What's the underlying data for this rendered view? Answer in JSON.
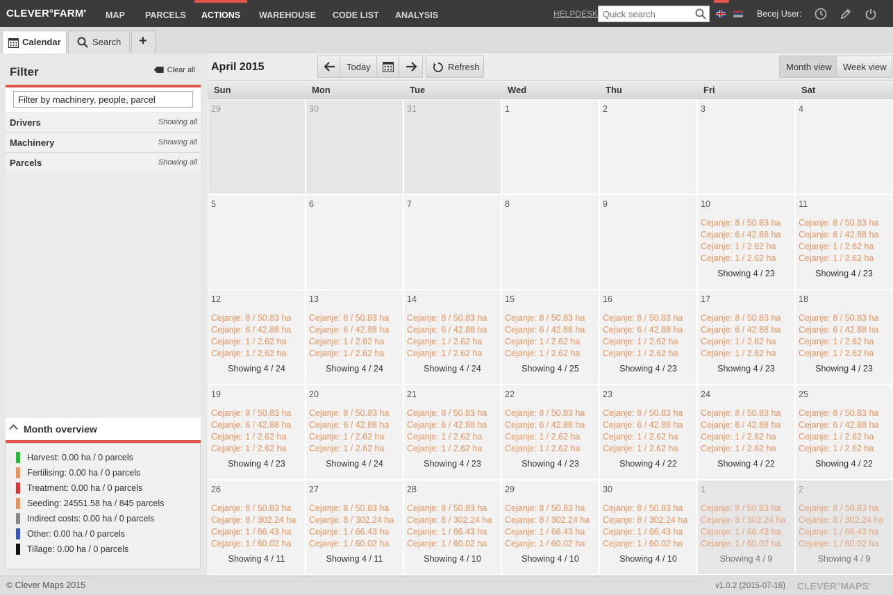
{
  "app": {
    "logo": "CLEVER°FARM'",
    "nav": [
      {
        "label": "MAP",
        "active": false
      },
      {
        "label": "PARCELS",
        "active": false
      },
      {
        "label": "ACTIONS",
        "active": true
      },
      {
        "label": "WAREHOUSE",
        "active": false
      },
      {
        "label": "CODE LIST",
        "active": false
      },
      {
        "label": "ANALYSIS",
        "active": false
      }
    ],
    "helpdesk": "HELPDESK",
    "search_placeholder": "Quick search",
    "user_label": "Becej User:",
    "accent_color": "#e0544a"
  },
  "tabs": {
    "calendar": "Calendar",
    "search": "Search",
    "add": "+"
  },
  "filter": {
    "title": "Filter",
    "clear_all": "Clear all",
    "input_value": "Filter by machinery, people, parcel",
    "rows": [
      {
        "label": "Drivers",
        "status": "Showing all"
      },
      {
        "label": "Machinery",
        "status": "Showing all"
      },
      {
        "label": "Parcels",
        "status": "Showing all"
      }
    ]
  },
  "overview": {
    "title": "Month overview",
    "items": [
      {
        "label": "Harvest: 0.00 ha / 0 parcels",
        "color": "#22bb33"
      },
      {
        "label": "Fertilising: 0.00 ha / 0 parcels",
        "color": "#e8925a"
      },
      {
        "label": "Treatment: 0.00 ha / 0 parcels",
        "color": "#dd3333"
      },
      {
        "label": "Seeding: 24551.58 ha / 845 parcels",
        "color": "#e8925a"
      },
      {
        "label": "Indirect costs: 0.00 ha / 0 parcels",
        "color": "#888888"
      },
      {
        "label": "Other: 0.00 ha / 0 parcels",
        "color": "#3355cc"
      },
      {
        "label": "Tillage: 0.00 ha / 0 parcels",
        "color": "#111111"
      }
    ]
  },
  "calendar": {
    "month_label": "April 2015",
    "today_label": "Today",
    "refresh_label": "Refresh",
    "month_view_label": "Month view",
    "week_view_label": "Week view",
    "event_color": "#e8925a",
    "day_names": [
      "Sun",
      "Mon",
      "Tue",
      "Wed",
      "Thu",
      "Fri",
      "Sat"
    ],
    "weeks": [
      [
        {
          "day": "29",
          "other": true,
          "events": [],
          "showing": ""
        },
        {
          "day": "30",
          "other": true,
          "events": [],
          "showing": ""
        },
        {
          "day": "31",
          "other": true,
          "events": [],
          "showing": ""
        },
        {
          "day": "1",
          "other": false,
          "events": [],
          "showing": ""
        },
        {
          "day": "2",
          "other": false,
          "events": [],
          "showing": ""
        },
        {
          "day": "3",
          "other": false,
          "events": [],
          "showing": ""
        },
        {
          "day": "4",
          "other": false,
          "events": [],
          "showing": ""
        }
      ],
      [
        {
          "day": "5",
          "other": false,
          "events": [],
          "showing": ""
        },
        {
          "day": "6",
          "other": false,
          "events": [],
          "showing": ""
        },
        {
          "day": "7",
          "other": false,
          "events": [],
          "showing": ""
        },
        {
          "day": "8",
          "other": false,
          "events": [],
          "showing": ""
        },
        {
          "day": "9",
          "other": false,
          "events": [],
          "showing": ""
        },
        {
          "day": "10",
          "other": false,
          "events": [
            "Cejanje: 8 / 50.83 ha",
            "Cejanje: 6 / 42.88 ha",
            "Cejanje: 1 / 2.62 ha",
            "Cejanje: 1 / 2.62 ha"
          ],
          "showing": "Showing 4 / 23"
        },
        {
          "day": "11",
          "other": false,
          "events": [
            "Cejanje: 8 / 50.83 ha",
            "Cejanje: 6 / 42.88 ha",
            "Cejanje: 1 / 2.62 ha",
            "Cejanje: 1 / 2.62 ha"
          ],
          "showing": "Showing 4 / 23"
        }
      ],
      [
        {
          "day": "12",
          "other": false,
          "events": [
            "Cejanje: 8 / 50.83 ha",
            "Cejanje: 6 / 42.88 ha",
            "Cejanje: 1 / 2.62 ha",
            "Cejanje: 1 / 2.62 ha"
          ],
          "showing": "Showing 4 / 24"
        },
        {
          "day": "13",
          "other": false,
          "events": [
            "Cejanje: 8 / 50.83 ha",
            "Cejanje: 6 / 42.88 ha",
            "Cejanje: 1 / 2.62 ha",
            "Cejanje: 1 / 2.62 ha"
          ],
          "showing": "Showing 4 / 24"
        },
        {
          "day": "14",
          "other": false,
          "events": [
            "Cejanje: 8 / 50.83 ha",
            "Cejanje: 6 / 42.88 ha",
            "Cejanje: 1 / 2.62 ha",
            "Cejanje: 1 / 2.62 ha"
          ],
          "showing": "Showing 4 / 24"
        },
        {
          "day": "15",
          "other": false,
          "events": [
            "Cejanje: 8 / 50.83 ha",
            "Cejanje: 6 / 42.88 ha",
            "Cejanje: 1 / 2.62 ha",
            "Cejanje: 1 / 2.62 ha"
          ],
          "showing": "Showing 4 / 25"
        },
        {
          "day": "16",
          "other": false,
          "events": [
            "Cejanje: 8 / 50.83 ha",
            "Cejanje: 6 / 42.88 ha",
            "Cejanje: 1 / 2.62 ha",
            "Cejanje: 1 / 2.62 ha"
          ],
          "showing": "Showing 4 / 23"
        },
        {
          "day": "17",
          "other": false,
          "events": [
            "Cejanje: 8 / 50.83 ha",
            "Cejanje: 6 / 42.88 ha",
            "Cejanje: 1 / 2.62 ha",
            "Cejanje: 1 / 2.62 ha"
          ],
          "showing": "Showing 4 / 23"
        },
        {
          "day": "18",
          "other": false,
          "events": [
            "Cejanje: 8 / 50.83 ha",
            "Cejanje: 6 / 42.88 ha",
            "Cejanje: 1 / 2.62 ha",
            "Cejanje: 1 / 2.62 ha"
          ],
          "showing": "Showing 4 / 23"
        }
      ],
      [
        {
          "day": "19",
          "other": false,
          "events": [
            "Cejanje: 8 / 50.83 ha",
            "Cejanje: 6 / 42.88 ha",
            "Cejanje: 1 / 2.62 ha",
            "Cejanje: 1 / 2.62 ha"
          ],
          "showing": "Showing 4 / 23"
        },
        {
          "day": "20",
          "other": false,
          "events": [
            "Cejanje: 8 / 50.83 ha",
            "Cejanje: 6 / 42.88 ha",
            "Cejanje: 1 / 2.62 ha",
            "Cejanje: 1 / 2.62 ha"
          ],
          "showing": "Showing 4 / 24"
        },
        {
          "day": "21",
          "other": false,
          "events": [
            "Cejanje: 8 / 50.83 ha",
            "Cejanje: 6 / 42.88 ha",
            "Cejanje: 1 / 2.62 ha",
            "Cejanje: 1 / 2.62 ha"
          ],
          "showing": "Showing 4 / 23"
        },
        {
          "day": "22",
          "other": false,
          "events": [
            "Cejanje: 8 / 50.83 ha",
            "Cejanje: 6 / 42.88 ha",
            "Cejanje: 1 / 2.62 ha",
            "Cejanje: 1 / 2.62 ha"
          ],
          "showing": "Showing 4 / 23"
        },
        {
          "day": "23",
          "other": false,
          "events": [
            "Cejanje: 8 / 50.83 ha",
            "Cejanje: 6 / 42.88 ha",
            "Cejanje: 1 / 2.62 ha",
            "Cejanje: 1 / 2.62 ha"
          ],
          "showing": "Showing 4 / 22"
        },
        {
          "day": "24",
          "other": false,
          "events": [
            "Cejanje: 8 / 50.83 ha",
            "Cejanje: 6 / 42.88 ha",
            "Cejanje: 1 / 2.62 ha",
            "Cejanje: 1 / 2.62 ha"
          ],
          "showing": "Showing 4 / 22"
        },
        {
          "day": "25",
          "other": false,
          "events": [
            "Cejanje: 8 / 50.83 ha",
            "Cejanje: 6 / 42.88 ha",
            "Cejanje: 1 / 2.62 ha",
            "Cejanje: 1 / 2.62 ha"
          ],
          "showing": "Showing 4 / 22"
        }
      ],
      [
        {
          "day": "26",
          "other": false,
          "events": [
            "Cejanje: 8 / 50.83 ha",
            "Cejanje: 8 / 302.24 ha",
            "Cejanje: 1 / 66.43 ha",
            "Cejanje: 1 / 60.02 ha"
          ],
          "showing": "Showing 4 / 11"
        },
        {
          "day": "27",
          "other": false,
          "events": [
            "Cejanje: 8 / 50.83 ha",
            "Cejanje: 8 / 302.24 ha",
            "Cejanje: 1 / 66.43 ha",
            "Cejanje: 1 / 60.02 ha"
          ],
          "showing": "Showing 4 / 11"
        },
        {
          "day": "28",
          "other": false,
          "events": [
            "Cejanje: 8 / 50.83 ha",
            "Cejanje: 8 / 302.24 ha",
            "Cejanje: 1 / 66.43 ha",
            "Cejanje: 1 / 60.02 ha"
          ],
          "showing": "Showing 4 / 10"
        },
        {
          "day": "29",
          "other": false,
          "events": [
            "Cejanje: 8 / 50.83 ha",
            "Cejanje: 8 / 302.24 ha",
            "Cejanje: 1 / 66.43 ha",
            "Cejanje: 1 / 60.02 ha"
          ],
          "showing": "Showing 4 / 10"
        },
        {
          "day": "30",
          "other": false,
          "events": [
            "Cejanje: 8 / 50.83 ha",
            "Cejanje: 8 / 302.24 ha",
            "Cejanje: 1 / 66.43 ha",
            "Cejanje: 1 / 60.02 ha"
          ],
          "showing": "Showing 4 / 10"
        },
        {
          "day": "1",
          "other": true,
          "events": [
            "Cejanje: 8 / 50.83 ha",
            "Cejanje: 8 / 302.24 ha",
            "Cejanje: 1 / 66.43 ha",
            "Cejanje: 1 / 60.02 ha"
          ],
          "showing": "Showing 4 / 9"
        },
        {
          "day": "2",
          "other": true,
          "events": [
            "Cejanje: 8 / 50.83 ha",
            "Cejanje: 8 / 302.24 ha",
            "Cejanje: 1 / 66.43 ha",
            "Cejanje: 1 / 60.02 ha"
          ],
          "showing": "Showing 4 / 9"
        }
      ]
    ]
  },
  "footer": {
    "copyright": "© Clever Maps 2015",
    "version": "v1.0.2 (2015-07-16)",
    "brand": "CLEVER°MAPS'"
  }
}
